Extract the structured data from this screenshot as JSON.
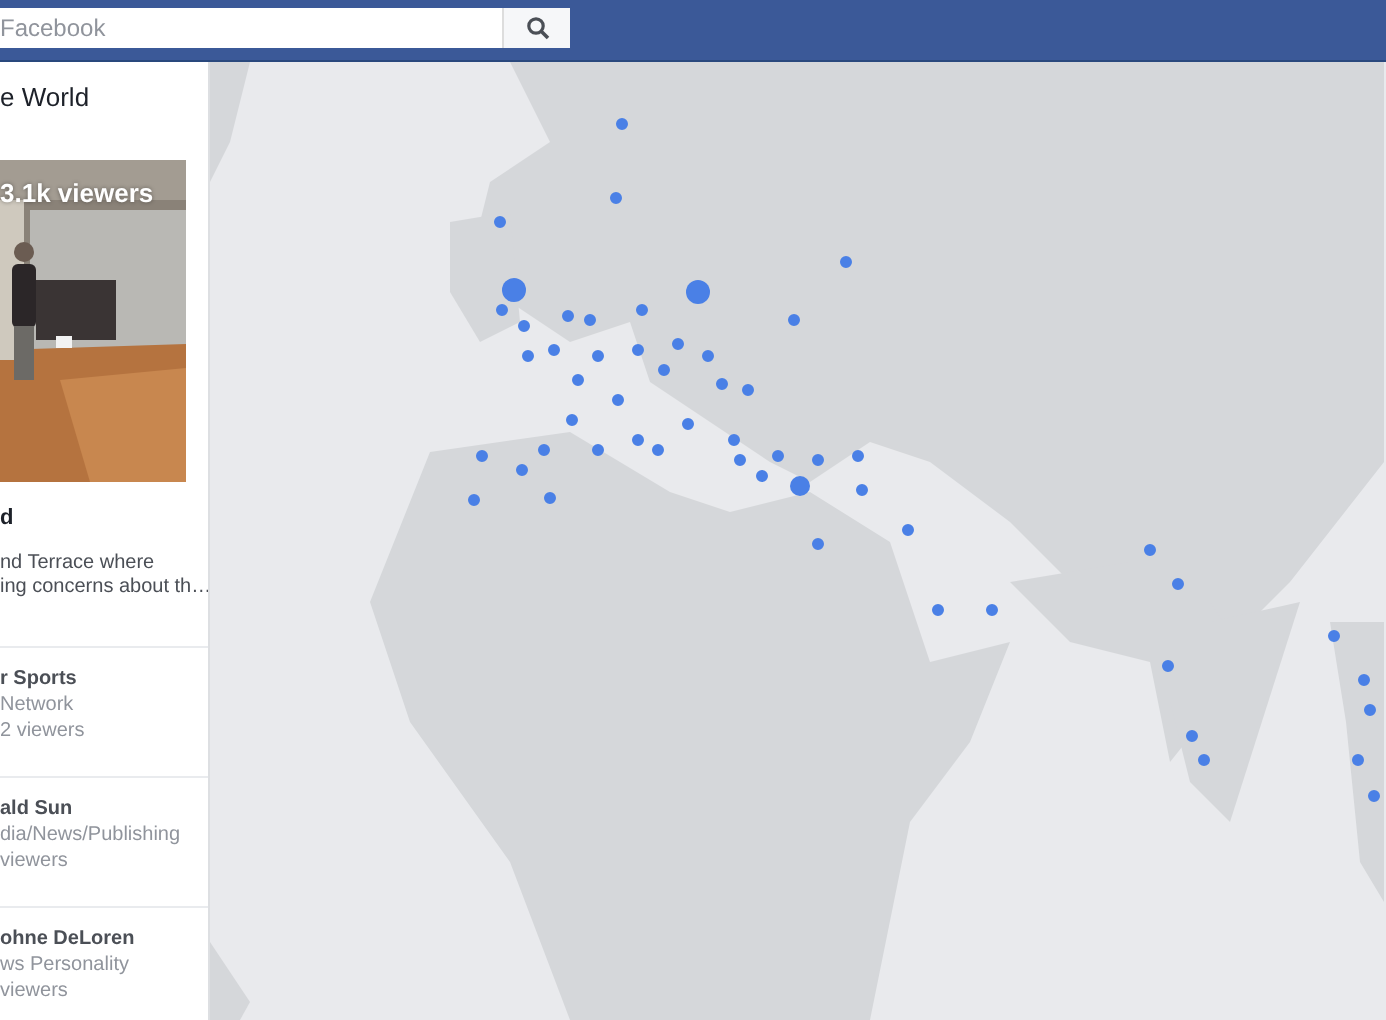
{
  "search": {
    "placeholder": "Facebook"
  },
  "sidebar": {
    "title": "e World",
    "featured": {
      "viewers": "3.1k viewers",
      "title": "d",
      "description_lines": [
        "nd Terrace where",
        "ing concerns about th…"
      ]
    },
    "streams": [
      {
        "name": "r Sports",
        "category": "Network",
        "viewers": "2 viewers"
      },
      {
        "name": "ald Sun",
        "category": "dia/News/Publishing",
        "viewers": "viewers"
      },
      {
        "name": "ohne DeLoren",
        "category": "ws Personality",
        "viewers": "viewers"
      }
    ]
  }
}
